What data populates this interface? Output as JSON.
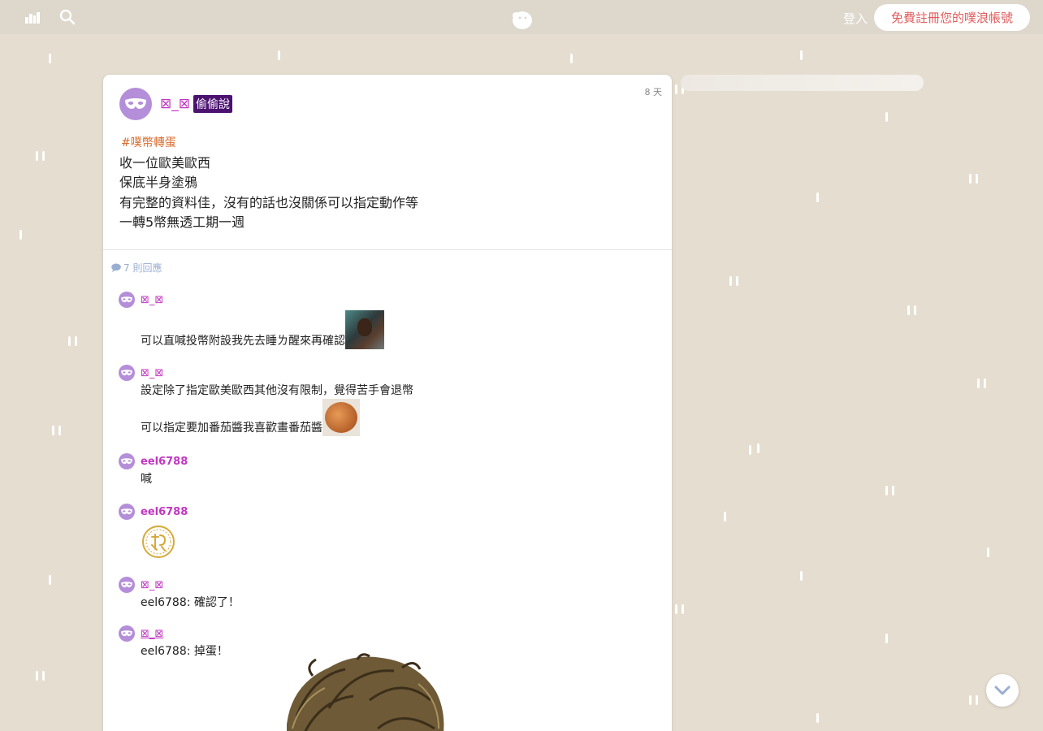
{
  "topbar": {
    "login_label": "登入",
    "register_label": "免費註冊您的噗浪帳號"
  },
  "post": {
    "author": "⊠_⊠",
    "badge": "偷偷說",
    "time": "8 天",
    "hashtag": "#噗幣轉蛋",
    "lines": [
      "收一位歐美歐西",
      "保底半身塗鴉",
      "有完整的資料佳，沒有的話也沒關係可以指定動作等",
      "一轉5幣無透工期一週"
    ]
  },
  "replies": {
    "count_label": "7 則回應",
    "items": [
      {
        "name": "⊠_⊠",
        "lines": [
          "可以直喊投幣附設我先去睡ㄌ醒來再確認"
        ]
      },
      {
        "name": "⊠_⊠",
        "lines": [
          "設定除了指定歐美歐西其他沒有限制，覺得苦手會退幣",
          "可以指定要加番茄醬我喜歡畫番茄醬"
        ]
      },
      {
        "name": "eel6788",
        "lines": [
          "喊"
        ]
      },
      {
        "name": "eel6788",
        "lines": []
      },
      {
        "name": "⊠_⊠",
        "lines": [
          "eel6788: 確認了！"
        ]
      },
      {
        "name": "⊠_⊠",
        "lines": [
          "eel6788: 掉蛋！"
        ]
      }
    ]
  },
  "colors": {
    "accent_name": "#c237c2",
    "badge_bg": "#4b1270",
    "register_text": "#e05c5c",
    "avatar": "#b48ed9"
  },
  "icons": {
    "topbar_left_1": "city-skyline-icon",
    "topbar_left_2": "search-icon",
    "topbar_center": "plurk-logo-icon",
    "scroll": "chevron-down-icon",
    "reply_count": "speech-bubble-icon",
    "avatar": "mask-icon"
  }
}
